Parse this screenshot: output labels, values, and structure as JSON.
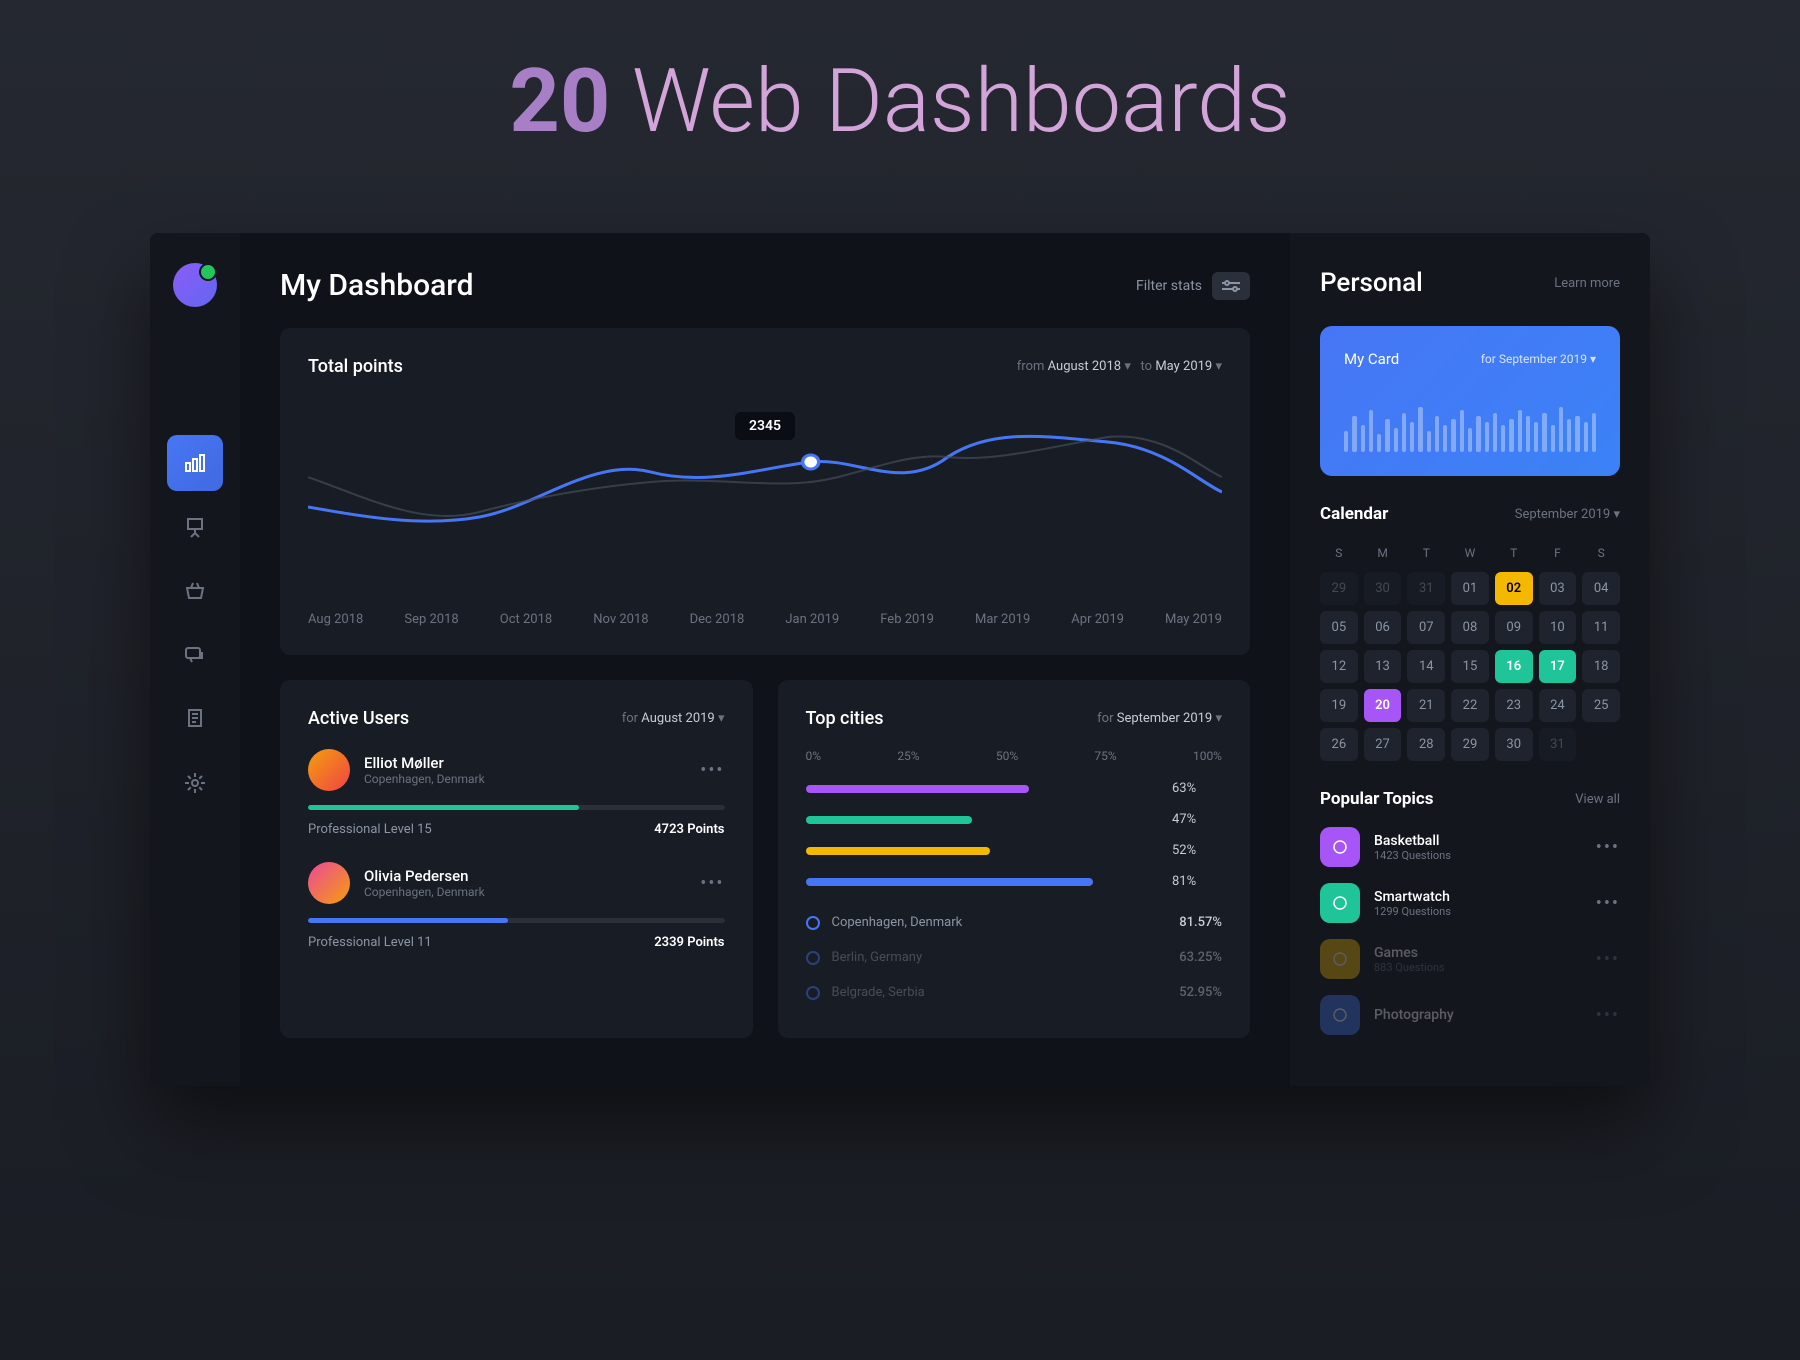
{
  "hero": {
    "bold": "20",
    "rest": " Web Dashboards"
  },
  "header": {
    "title": "My Dashboard",
    "filter": "Filter stats"
  },
  "total": {
    "title": "Total points",
    "from_lbl": "from",
    "from_val": "August 2018",
    "to_lbl": "to",
    "to_val": "May 2019",
    "tooltip": "2345",
    "labels": [
      "Aug 2018",
      "Sep 2018",
      "Oct 2018",
      "Nov 2018",
      "Dec 2018",
      "Jan 2019",
      "Feb 2019",
      "Mar 2019",
      "Apr 2019",
      "May 2019"
    ]
  },
  "active": {
    "title": "Active Users",
    "for_lbl": "for",
    "for_val": "August 2019",
    "users": [
      {
        "name": "Elliot Møller",
        "loc": "Copenhagen, Denmark",
        "level": "Professional Level 15",
        "points": "4723 Points",
        "pct": 65,
        "color": "#1fc598"
      },
      {
        "name": "Olivia Pedersen",
        "loc": "Copenhagen, Denmark",
        "level": "Professional Level 11",
        "points": "2339 Points",
        "pct": 48,
        "color": "#4776f5"
      }
    ]
  },
  "cities": {
    "title": "Top cities",
    "for_lbl": "for",
    "for_val": "September 2019",
    "ticks": [
      "0%",
      "25%",
      "50%",
      "75%",
      "100%"
    ],
    "bars": [
      {
        "pct": 63,
        "color": "#a855f7",
        "label": "63%"
      },
      {
        "pct": 47,
        "color": "#1fc598",
        "label": "47%"
      },
      {
        "pct": 52,
        "color": "#f5b800",
        "label": "52%"
      },
      {
        "pct": 81,
        "color": "#4776f5",
        "label": "81%"
      }
    ],
    "list": [
      {
        "name": "Copenhagen, Denmark",
        "val": "81.57%",
        "faded": false
      },
      {
        "name": "Berlin, Germany",
        "val": "63.25%",
        "faded": true
      },
      {
        "name": "Belgrade, Serbia",
        "val": "52.95%",
        "faded": true
      }
    ]
  },
  "personal": {
    "title": "Personal",
    "learn": "Learn more"
  },
  "mycard": {
    "title": "My Card",
    "for_lbl": "for",
    "for_val": "September 2019",
    "spark": [
      35,
      60,
      45,
      70,
      30,
      55,
      40,
      65,
      50,
      75,
      35,
      60,
      45,
      55,
      70,
      40,
      60,
      50,
      65,
      45,
      55,
      70,
      60,
      50,
      65,
      45,
      75,
      55,
      60,
      50,
      65
    ]
  },
  "calendar": {
    "title": "Calendar",
    "for_val": "September 2019",
    "dow": [
      "S",
      "M",
      "T",
      "W",
      "T",
      "F",
      "S"
    ],
    "days": [
      {
        "n": "29",
        "muted": true
      },
      {
        "n": "30",
        "muted": true
      },
      {
        "n": "31",
        "muted": true
      },
      {
        "n": "01"
      },
      {
        "n": "02",
        "cls": "yellow"
      },
      {
        "n": "03"
      },
      {
        "n": "04"
      },
      {
        "n": "05"
      },
      {
        "n": "06"
      },
      {
        "n": "07"
      },
      {
        "n": "08"
      },
      {
        "n": "09"
      },
      {
        "n": "10"
      },
      {
        "n": "11"
      },
      {
        "n": "12"
      },
      {
        "n": "13"
      },
      {
        "n": "14"
      },
      {
        "n": "15"
      },
      {
        "n": "16",
        "cls": "green"
      },
      {
        "n": "17",
        "cls": "green"
      },
      {
        "n": "18"
      },
      {
        "n": "19"
      },
      {
        "n": "20",
        "cls": "purple"
      },
      {
        "n": "21"
      },
      {
        "n": "22"
      },
      {
        "n": "23"
      },
      {
        "n": "24"
      },
      {
        "n": "25"
      },
      {
        "n": "26"
      },
      {
        "n": "27"
      },
      {
        "n": "28"
      },
      {
        "n": "29"
      },
      {
        "n": "30"
      },
      {
        "n": "31",
        "muted": true
      }
    ]
  },
  "topics": {
    "title": "Popular Topics",
    "view": "View all",
    "items": [
      {
        "name": "Basketball",
        "sub": "1423 Questions",
        "color": "#a855f7"
      },
      {
        "name": "Smartwatch",
        "sub": "1299 Questions",
        "color": "#1fc598"
      },
      {
        "name": "Games",
        "sub": "883 Questions",
        "color": "#f5b800",
        "faded": true
      },
      {
        "name": "Photography",
        "sub": "",
        "color": "#4776f5",
        "faded": true
      }
    ]
  },
  "chart_data": {
    "type": "line",
    "categories": [
      "Aug 2018",
      "Sep 2018",
      "Oct 2018",
      "Nov 2018",
      "Dec 2018",
      "Jan 2019",
      "Feb 2019",
      "Mar 2019",
      "Apr 2019",
      "May 2019"
    ],
    "series": [
      {
        "name": "primary",
        "values": [
          1800,
          1700,
          1900,
          2400,
          2100,
          2345,
          2200,
          2500,
          2700,
          2300
        ]
      },
      {
        "name": "secondary",
        "values": [
          2100,
          1600,
          1850,
          2050,
          2200,
          2000,
          2400,
          2350,
          2600,
          2200
        ]
      }
    ],
    "tooltip_point": {
      "x": "Jan 2019",
      "y": 2345
    }
  }
}
